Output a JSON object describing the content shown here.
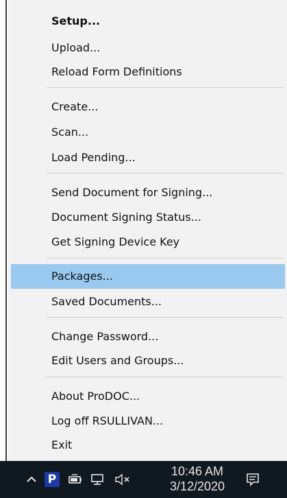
{
  "menu": {
    "groups": [
      {
        "items": [
          {
            "label": "Setup...",
            "bold": true
          },
          {
            "label": "Upload..."
          },
          {
            "label": "Reload Form Definitions"
          }
        ]
      },
      {
        "items": [
          {
            "label": "Create..."
          },
          {
            "label": "Scan..."
          },
          {
            "label": "Load Pending..."
          }
        ]
      },
      {
        "items": [
          {
            "label": "Send Document for Signing..."
          },
          {
            "label": "Document Signing Status..."
          },
          {
            "label": "Get Signing Device Key"
          }
        ]
      },
      {
        "items": [
          {
            "label": "Packages...",
            "highlighted": true
          },
          {
            "label": "Saved Documents..."
          }
        ]
      },
      {
        "items": [
          {
            "label": "Change Password..."
          },
          {
            "label": "Edit Users and Groups..."
          }
        ]
      },
      {
        "items": [
          {
            "label": "About ProDOC..."
          },
          {
            "label": "Log off RSULLIVAN..."
          },
          {
            "label": "Exit"
          }
        ]
      }
    ]
  },
  "taskbar": {
    "time": "10:46 AM",
    "date": "3/12/2020",
    "icons": [
      "chevron-up-icon",
      "prodoc-app-icon",
      "power-icon",
      "network-icon",
      "volume-muted-icon",
      "notification-icon"
    ],
    "app_letter": "P",
    "colors": {
      "background": "#101820",
      "highlight": "#99c9ef"
    }
  }
}
